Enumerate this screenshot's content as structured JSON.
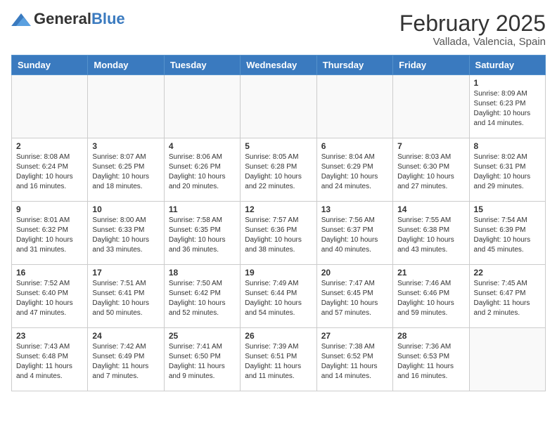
{
  "header": {
    "logo_general": "General",
    "logo_blue": "Blue",
    "month_title": "February 2025",
    "location": "Vallada, Valencia, Spain"
  },
  "weekdays": [
    "Sunday",
    "Monday",
    "Tuesday",
    "Wednesday",
    "Thursday",
    "Friday",
    "Saturday"
  ],
  "weeks": [
    [
      {
        "day": "",
        "info": ""
      },
      {
        "day": "",
        "info": ""
      },
      {
        "day": "",
        "info": ""
      },
      {
        "day": "",
        "info": ""
      },
      {
        "day": "",
        "info": ""
      },
      {
        "day": "",
        "info": ""
      },
      {
        "day": "1",
        "info": "Sunrise: 8:09 AM\nSunset: 6:23 PM\nDaylight: 10 hours\nand 14 minutes."
      }
    ],
    [
      {
        "day": "2",
        "info": "Sunrise: 8:08 AM\nSunset: 6:24 PM\nDaylight: 10 hours\nand 16 minutes."
      },
      {
        "day": "3",
        "info": "Sunrise: 8:07 AM\nSunset: 6:25 PM\nDaylight: 10 hours\nand 18 minutes."
      },
      {
        "day": "4",
        "info": "Sunrise: 8:06 AM\nSunset: 6:26 PM\nDaylight: 10 hours\nand 20 minutes."
      },
      {
        "day": "5",
        "info": "Sunrise: 8:05 AM\nSunset: 6:28 PM\nDaylight: 10 hours\nand 22 minutes."
      },
      {
        "day": "6",
        "info": "Sunrise: 8:04 AM\nSunset: 6:29 PM\nDaylight: 10 hours\nand 24 minutes."
      },
      {
        "day": "7",
        "info": "Sunrise: 8:03 AM\nSunset: 6:30 PM\nDaylight: 10 hours\nand 27 minutes."
      },
      {
        "day": "8",
        "info": "Sunrise: 8:02 AM\nSunset: 6:31 PM\nDaylight: 10 hours\nand 29 minutes."
      }
    ],
    [
      {
        "day": "9",
        "info": "Sunrise: 8:01 AM\nSunset: 6:32 PM\nDaylight: 10 hours\nand 31 minutes."
      },
      {
        "day": "10",
        "info": "Sunrise: 8:00 AM\nSunset: 6:33 PM\nDaylight: 10 hours\nand 33 minutes."
      },
      {
        "day": "11",
        "info": "Sunrise: 7:58 AM\nSunset: 6:35 PM\nDaylight: 10 hours\nand 36 minutes."
      },
      {
        "day": "12",
        "info": "Sunrise: 7:57 AM\nSunset: 6:36 PM\nDaylight: 10 hours\nand 38 minutes."
      },
      {
        "day": "13",
        "info": "Sunrise: 7:56 AM\nSunset: 6:37 PM\nDaylight: 10 hours\nand 40 minutes."
      },
      {
        "day": "14",
        "info": "Sunrise: 7:55 AM\nSunset: 6:38 PM\nDaylight: 10 hours\nand 43 minutes."
      },
      {
        "day": "15",
        "info": "Sunrise: 7:54 AM\nSunset: 6:39 PM\nDaylight: 10 hours\nand 45 minutes."
      }
    ],
    [
      {
        "day": "16",
        "info": "Sunrise: 7:52 AM\nSunset: 6:40 PM\nDaylight: 10 hours\nand 47 minutes."
      },
      {
        "day": "17",
        "info": "Sunrise: 7:51 AM\nSunset: 6:41 PM\nDaylight: 10 hours\nand 50 minutes."
      },
      {
        "day": "18",
        "info": "Sunrise: 7:50 AM\nSunset: 6:42 PM\nDaylight: 10 hours\nand 52 minutes."
      },
      {
        "day": "19",
        "info": "Sunrise: 7:49 AM\nSunset: 6:44 PM\nDaylight: 10 hours\nand 54 minutes."
      },
      {
        "day": "20",
        "info": "Sunrise: 7:47 AM\nSunset: 6:45 PM\nDaylight: 10 hours\nand 57 minutes."
      },
      {
        "day": "21",
        "info": "Sunrise: 7:46 AM\nSunset: 6:46 PM\nDaylight: 10 hours\nand 59 minutes."
      },
      {
        "day": "22",
        "info": "Sunrise: 7:45 AM\nSunset: 6:47 PM\nDaylight: 11 hours\nand 2 minutes."
      }
    ],
    [
      {
        "day": "23",
        "info": "Sunrise: 7:43 AM\nSunset: 6:48 PM\nDaylight: 11 hours\nand 4 minutes."
      },
      {
        "day": "24",
        "info": "Sunrise: 7:42 AM\nSunset: 6:49 PM\nDaylight: 11 hours\nand 7 minutes."
      },
      {
        "day": "25",
        "info": "Sunrise: 7:41 AM\nSunset: 6:50 PM\nDaylight: 11 hours\nand 9 minutes."
      },
      {
        "day": "26",
        "info": "Sunrise: 7:39 AM\nSunset: 6:51 PM\nDaylight: 11 hours\nand 11 minutes."
      },
      {
        "day": "27",
        "info": "Sunrise: 7:38 AM\nSunset: 6:52 PM\nDaylight: 11 hours\nand 14 minutes."
      },
      {
        "day": "28",
        "info": "Sunrise: 7:36 AM\nSunset: 6:53 PM\nDaylight: 11 hours\nand 16 minutes."
      },
      {
        "day": "",
        "info": ""
      }
    ]
  ]
}
